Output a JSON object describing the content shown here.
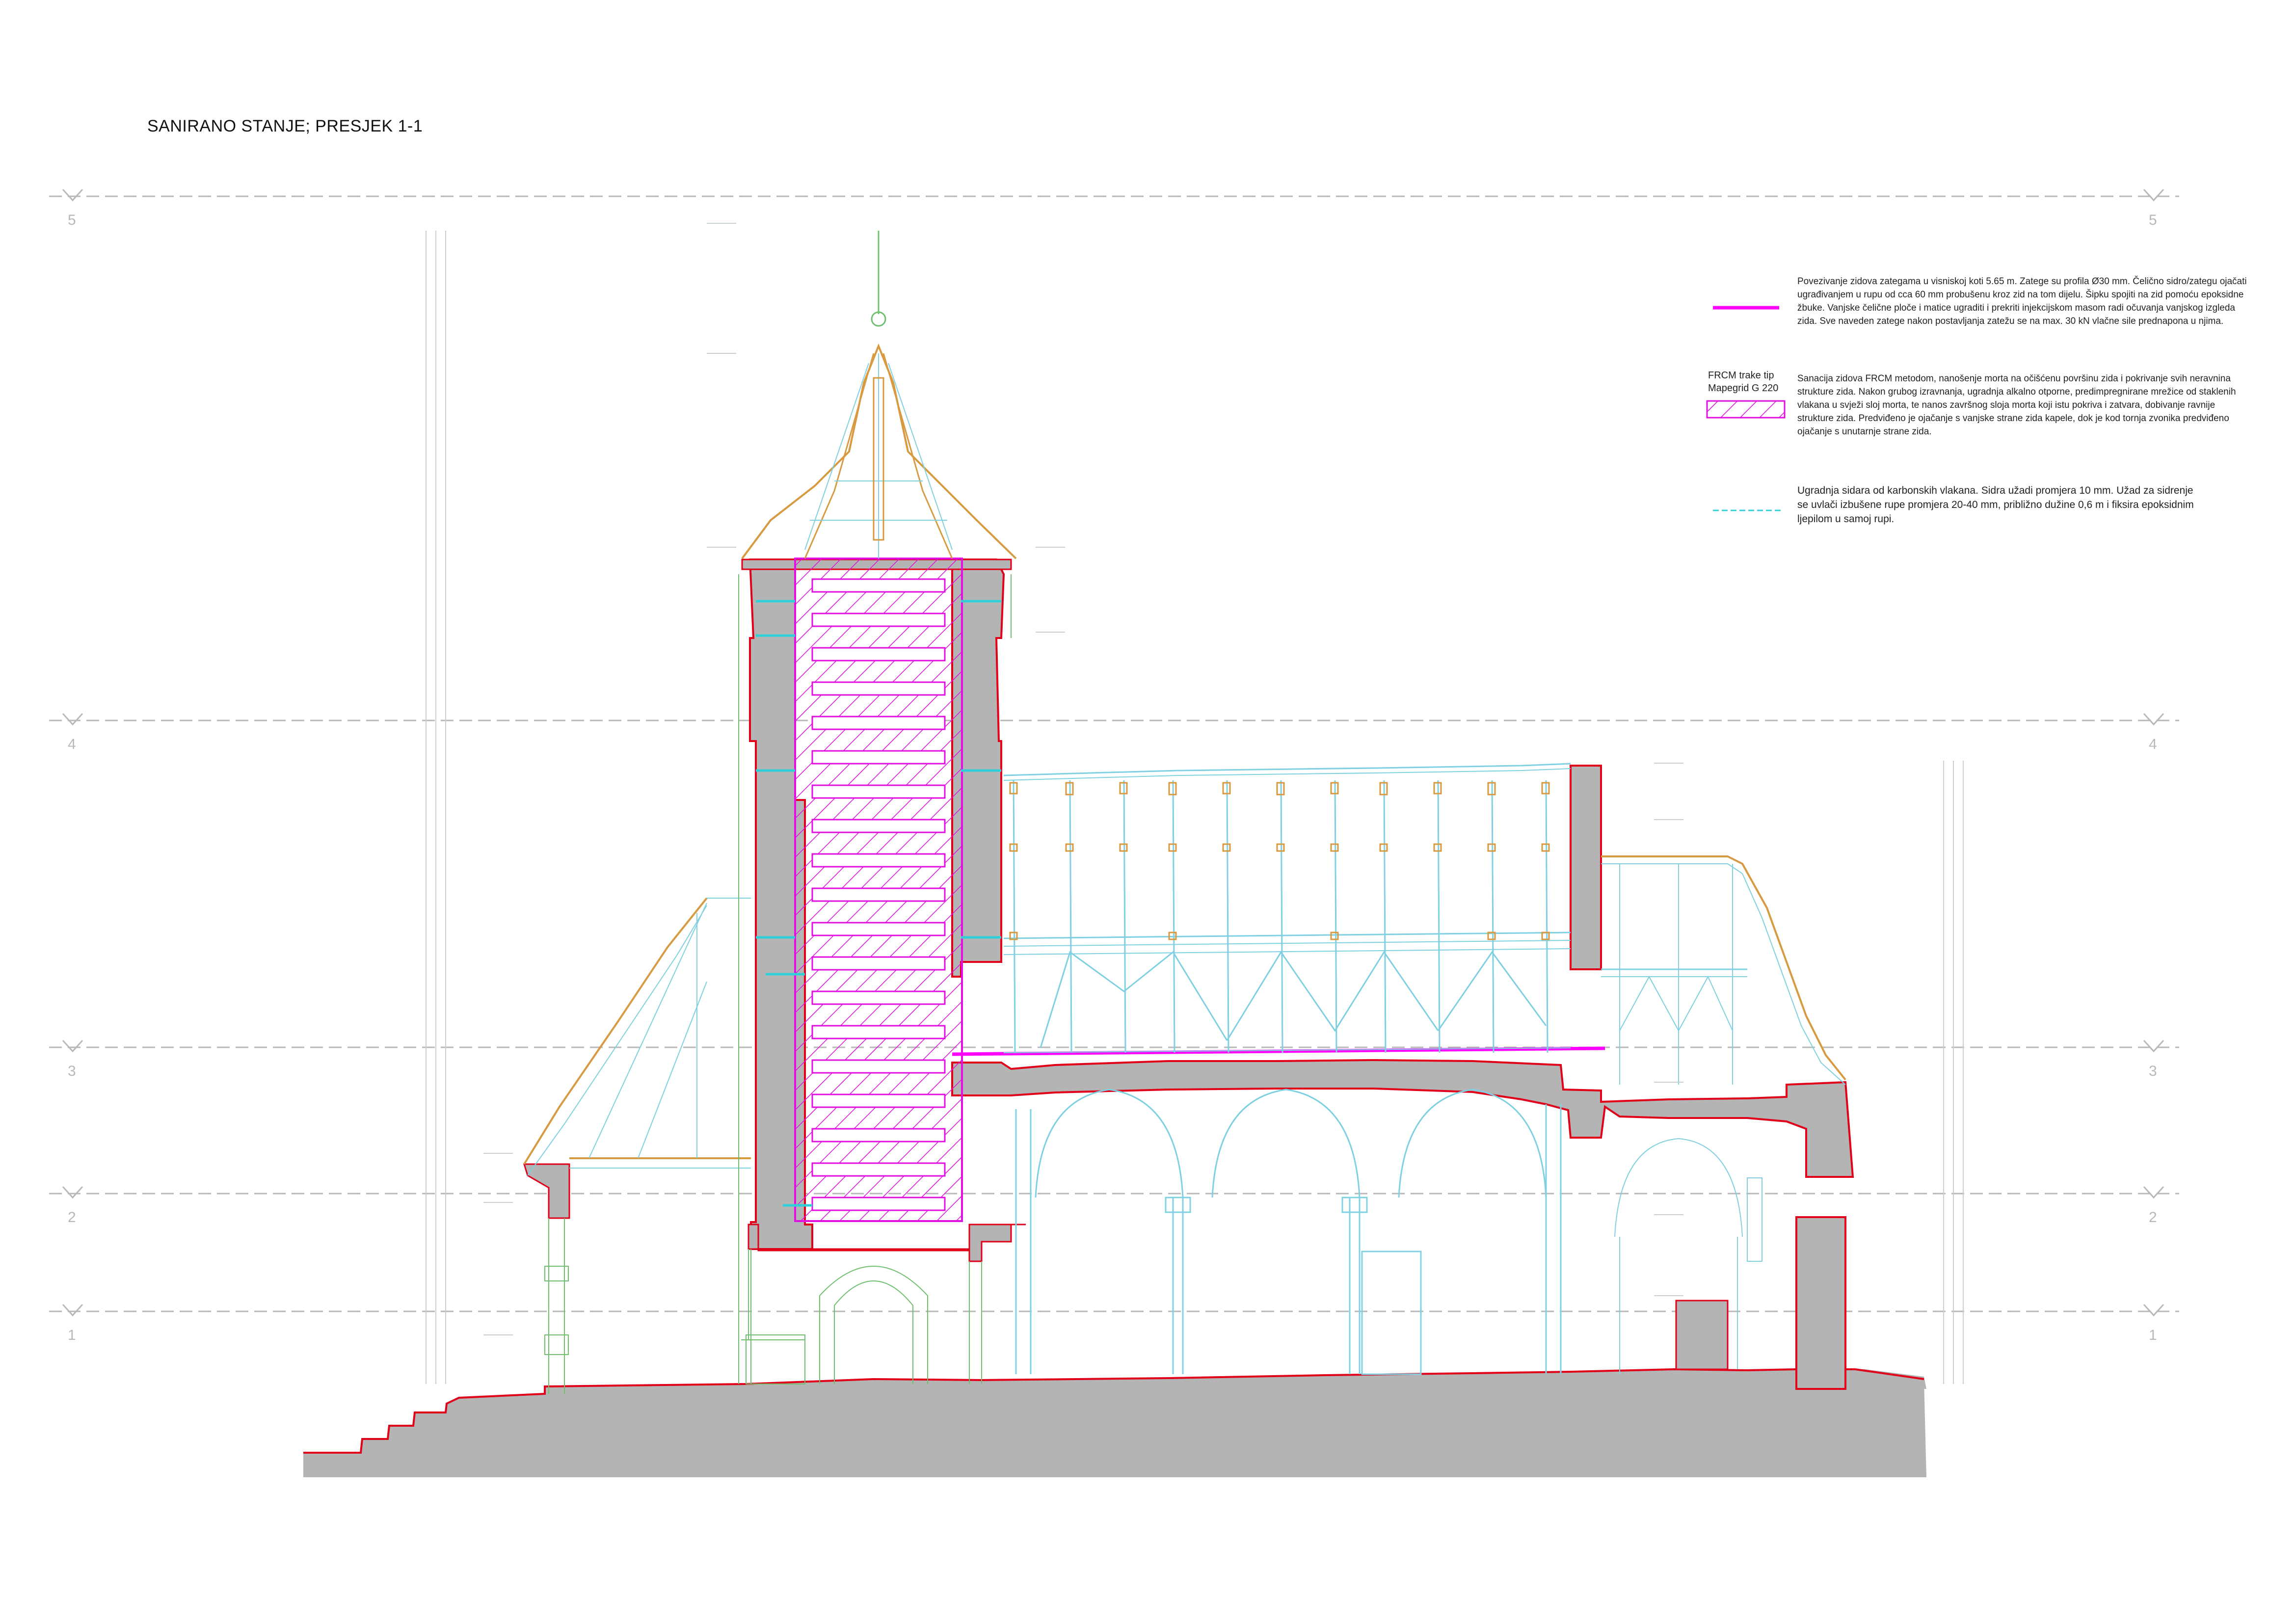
{
  "title": "SANIRANO STANJE; PRESJEK 1-1",
  "levels": {
    "left": [
      "5",
      "4",
      "3",
      "2",
      "1"
    ],
    "right": [
      "5",
      "4",
      "3",
      "2",
      "1"
    ]
  },
  "legend": {
    "tie_rod": {
      "lines": [
        "Povezivanje zidova zategama u visniskoj koti 5.65 m. Zatege su profila Ø30 mm. Čelično sidro/zategu ojačati",
        "ugrađivanjem u rupu od cca 60 mm probušenu kroz zid na tom dijelu. Šipku spojiti na zid pomoću epoksidne",
        "žbuke. Vanjske čelične ploče i matice ugraditi  i prekriti injekcijskom masom radi očuvanja vanjskog izgleda",
        "zida. Sve naveden zatege nakon postavljanja zatežu se na max. 30 kN vlačne sile prednapona u njima."
      ],
      "color": "#ff00ff"
    },
    "frcm": {
      "label_lines": [
        "FRCM trake tip",
        "Mapegrid G 220"
      ],
      "lines": [
        "Sanacija zidova FRCM metodom, nanošenje morta na očišćenu površinu zida i pokrivanje svih neravnina",
        "strukture zida. Nakon grubog izravnanja, ugradnja alkalno otporne, predimpregnirane mrežice od staklenih",
        "vlakana u svježi sloj morta, te nanos završnog sloja morta koji istu pokriva i zatvara, dobivanje ravnije",
        "strukture zida. Predviđeno je ojačanje s vanjske strane zida kapele, dok je kod tornja zvonika predviđeno",
        "ojačanje s unutarnje strane zida."
      ],
      "color": "#e010e0"
    },
    "anchors": {
      "lines": [
        "Ugradnja sidara od karbonskih  vlakana.  Sidra  užadi  promjera 10 mm. Užad  za sidrenje",
        "se uvlači izbušene rupe promjera 20-40 mm, približno dužine 0,6 m i fiksira epoksidnim",
        "ljepilom u samoj rupi."
      ],
      "color": "#30d0d8"
    }
  },
  "colors": {
    "section_fill": "#b4b4b4",
    "section_outline": "#e0001a",
    "timber": "#d89a40",
    "cyan_lines": "#7fd0e0",
    "green_lines": "#70c070",
    "level_lines": "#b8b8b8"
  }
}
